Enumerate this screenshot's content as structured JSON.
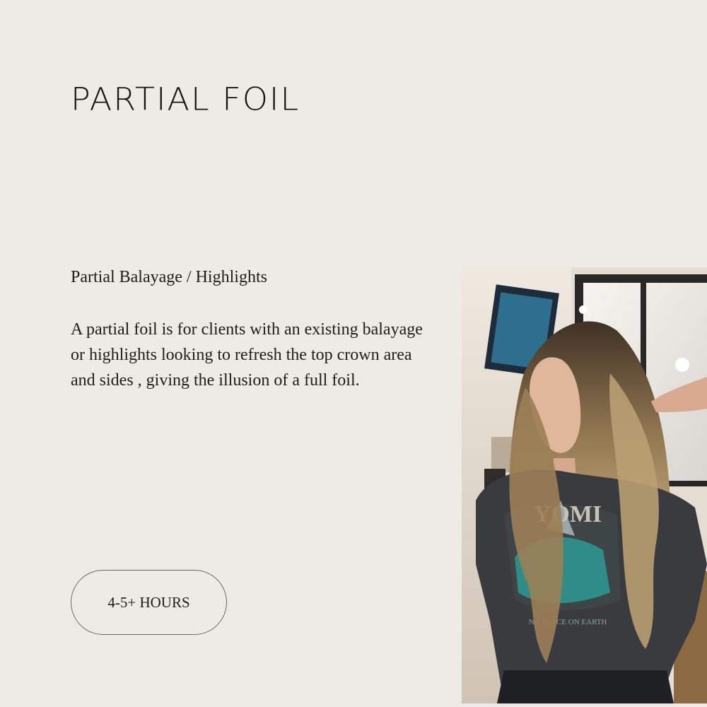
{
  "page": {
    "title": "PARTIAL FOIL",
    "subtitle": "Partial Balayage / Highlights",
    "description": "A partial foil is for clients with an existing balayage or highlights looking to refresh the top crown area and sides , giving the illusion of a full foil.",
    "duration_label": "4-5+ HOURS"
  },
  "colors": {
    "background": "#eeebe6",
    "text": "#1f1d1b",
    "pill_border": "#6b6763"
  },
  "photo": {
    "shirt_text": "YOMI",
    "shirt_subtext": "NO PLACE ON EARTH"
  }
}
